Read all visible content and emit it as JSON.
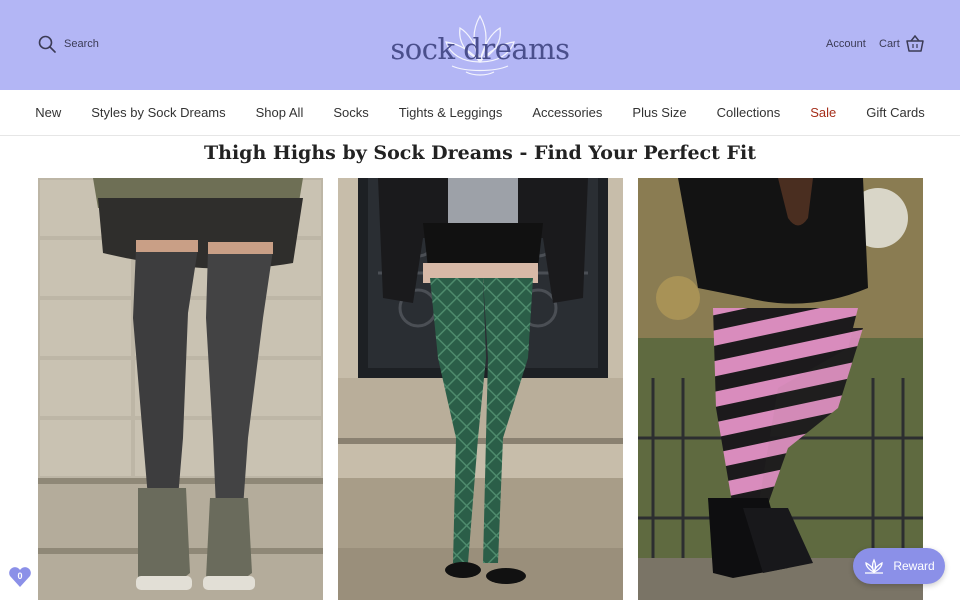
{
  "header": {
    "search_label": "Search",
    "logo_text": "sock dreams",
    "account_label": "Account",
    "cart_label": "Cart",
    "background": "#b3b6f5"
  },
  "nav": {
    "items": [
      {
        "label": "New"
      },
      {
        "label": "Styles by Sock Dreams"
      },
      {
        "label": "Shop All"
      },
      {
        "label": "Socks"
      },
      {
        "label": "Tights & Leggings"
      },
      {
        "label": "Accessories"
      },
      {
        "label": "Plus Size"
      },
      {
        "label": "Collections"
      },
      {
        "label": "Sale"
      },
      {
        "label": "Gift Cards"
      }
    ],
    "sale_color": "#a52e1a"
  },
  "page": {
    "title": "Thigh Highs by Sock Dreams - Find Your Perfect Fit"
  },
  "products": [
    {
      "image": "charcoal-thigh-high-socks-photo"
    },
    {
      "image": "green-diamond-thigh-high-socks-photo"
    },
    {
      "image": "pink-black-striped-thigh-high-socks-photo"
    }
  ],
  "wishlist": {
    "count": "0",
    "icon": "heart-icon"
  },
  "reward": {
    "label": "Reward",
    "icon": "gift-icon",
    "color": "#8b90e8"
  }
}
